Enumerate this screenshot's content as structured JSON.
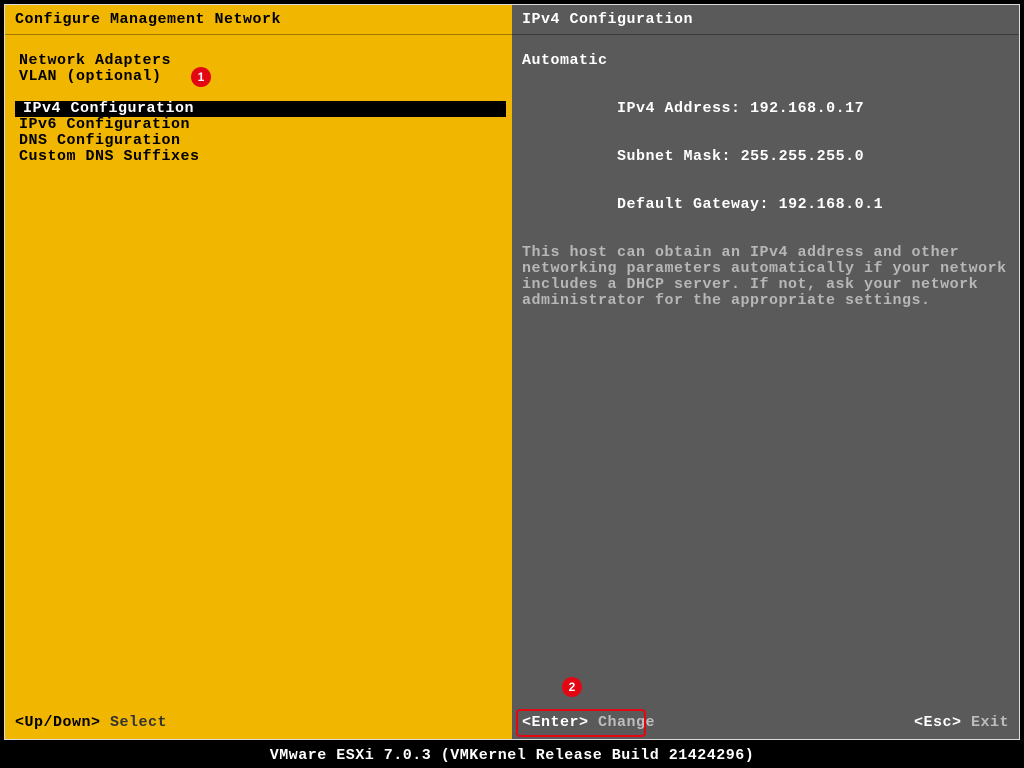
{
  "statusbar": "VMware ESXi 7.0.3 (VMKernel Release Build 21424296)",
  "left": {
    "title": "Configure Management Network",
    "group1": [
      "Network Adapters",
      "VLAN (optional)"
    ],
    "selected": "IPv4 Configuration",
    "group2": [
      "IPv6 Configuration",
      "DNS Configuration",
      "Custom DNS Suffixes"
    ],
    "hint_keys": "<Up/Down>",
    "hint_action": "Select"
  },
  "right": {
    "title": "IPv4 Configuration",
    "mode": "Automatic",
    "addr_label": "IPv4 Address:",
    "addr_value": "192.168.0.17",
    "mask_label": "Subnet Mask:",
    "mask_value": "255.255.255.0",
    "gw_label": "Default Gateway:",
    "gw_value": "192.168.0.1",
    "help": "This host can obtain an IPv4 address and other networking parameters automatically if your network includes a DHCP server. If not, ask your network administrator for the appropriate settings.",
    "enter_key": "<Enter>",
    "enter_action": "Change",
    "esc_key": "<Esc>",
    "esc_action": "Exit"
  },
  "callouts": {
    "b1": "1",
    "b2": "2"
  }
}
